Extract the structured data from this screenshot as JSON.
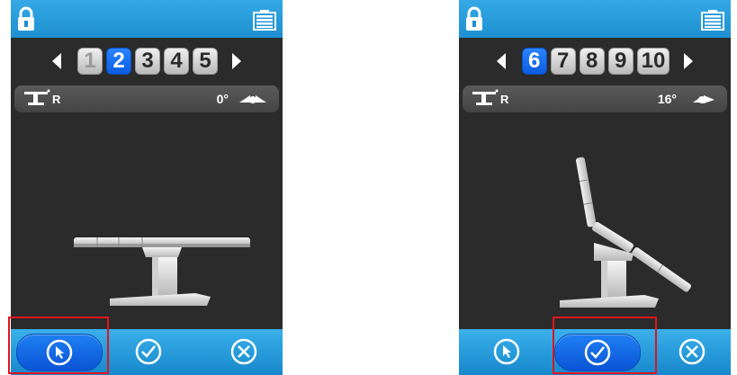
{
  "screens": [
    {
      "pages": [
        {
          "label": "1",
          "state": "dim"
        },
        {
          "label": "2",
          "state": "active"
        },
        {
          "label": "3",
          "state": "normal"
        },
        {
          "label": "4",
          "state": "normal"
        },
        {
          "label": "5",
          "state": "normal"
        }
      ],
      "status": {
        "r_label": "R",
        "angle": "0°"
      },
      "chair_position": "flat",
      "selected_action": "select"
    },
    {
      "pages": [
        {
          "label": "6",
          "state": "active"
        },
        {
          "label": "7",
          "state": "normal"
        },
        {
          "label": "8",
          "state": "normal"
        },
        {
          "label": "9",
          "state": "normal"
        },
        {
          "label": "10",
          "state": "normal"
        }
      ],
      "status": {
        "r_label": "R",
        "angle": "16°"
      },
      "chair_position": "reclined",
      "selected_action": "confirm"
    }
  ],
  "icons": {
    "top_left": "lock-icon",
    "top_right": "battery-icon",
    "status_left": "operating-table-icon",
    "status_right": "tilt-icon",
    "actions": [
      "pointer-icon",
      "check-icon",
      "cancel-icon"
    ]
  },
  "colors": {
    "bar_blue": "#1d8fd0",
    "active_page": "#0b5de0",
    "screen_bg": "#2b2b2b",
    "highlight": "#e0141c"
  }
}
